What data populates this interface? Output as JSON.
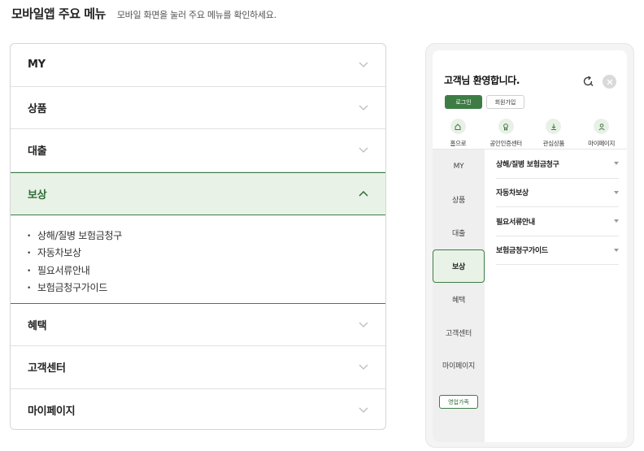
{
  "header": {
    "title": "모바일앱 주요 메뉴",
    "subtitle": "모바일 화면을 눌러 주요 메뉴를 확인하세요."
  },
  "accordion": {
    "items": [
      {
        "label": "MY"
      },
      {
        "label": "상품"
      },
      {
        "label": "대출"
      },
      {
        "label": "보상",
        "expanded": true
      },
      {
        "label": "혜택"
      },
      {
        "label": "고객센터"
      },
      {
        "label": "마이페이지"
      }
    ],
    "expanded_panel": [
      "상해/질병 보험금청구",
      "자동차보상",
      "필요서류안내",
      "보험금청구가이드"
    ]
  },
  "phone": {
    "welcome": "고객님 환영합니다.",
    "login_label": "로그인",
    "join_label": "회원가입",
    "quick_links": [
      {
        "label": "홈으로",
        "icon": "home-icon"
      },
      {
        "label": "공인인증센터",
        "icon": "certificate-icon"
      },
      {
        "label": "관심상품",
        "icon": "download-icon"
      },
      {
        "label": "마이페이지",
        "icon": "person-icon"
      }
    ],
    "side_menu": [
      "MY",
      "상품",
      "대출",
      "보상",
      "혜택",
      "고객센터",
      "마이페이지"
    ],
    "side_active": "보상",
    "sales_label": "영업가족",
    "content_items": [
      "상해/질병 보험금청구",
      "자동차보상",
      "필요서류안내",
      "보험금청구가이드"
    ]
  },
  "colors": {
    "accent": "#3e7c46",
    "accent_bg": "#e9f2e6"
  }
}
